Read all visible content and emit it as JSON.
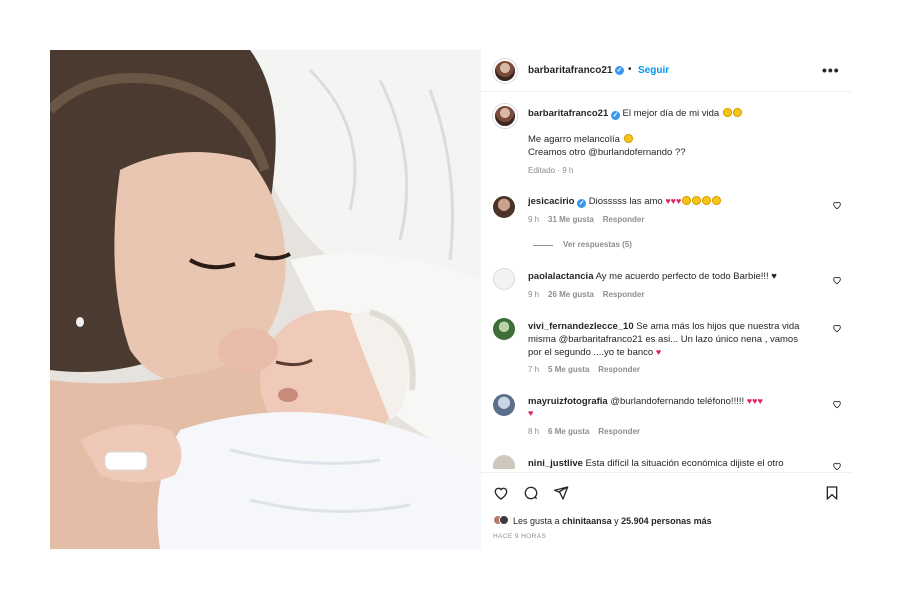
{
  "post": {
    "author": "barbaritafranco21",
    "follow_label": "Seguir",
    "header_separator": "•",
    "more_label": "•••",
    "caption_user": "barbaritafranco21",
    "caption_line1": "El mejor día de mi vida",
    "caption_line2": "Me agarro melancolía",
    "caption_line3": "Creamos otro @burlandofernando ??",
    "caption_meta": "Editado · 9 h"
  },
  "comments": [
    {
      "user": "jesicacirio",
      "text": "Diosssss las amo",
      "time": "9 h",
      "likes": "31 Me gusta",
      "reply": "Responder",
      "view_replies": "Ver respuestas (5)"
    },
    {
      "user": "paolalactancia",
      "text": "Ay me acuerdo perfecto de todo Barbie!!! ♥",
      "time": "9 h",
      "likes": "26 Me gusta",
      "reply": "Responder"
    },
    {
      "user": "vivi_fernandezlecce_10",
      "text_line1": "Se ama más los hijos que nuestra vida",
      "text_line2": "misma @barbaritafranco21 es asi... Un lazo único nena , vamos",
      "text_line3": "por el segundo ....yo te banco",
      "time": "7 h",
      "likes": "5 Me gusta",
      "reply": "Responder"
    },
    {
      "user": "mayruizfotografia",
      "text": "@burlandofernando teléfono!!!!!",
      "time": "8 h",
      "likes": "6 Me gusta",
      "reply": "Responder"
    },
    {
      "user": "nini_justlive",
      "text": "Esta difícil la situación económica dijiste el otro"
    }
  ],
  "footer": {
    "likes_prefix": "Les gusta a",
    "likes_user": "chinitaansa",
    "likes_connector": "y",
    "likes_count": "25.904 personas más",
    "timestamp": "HACE 9 HORAS"
  },
  "icons": {
    "like": "heart-icon",
    "comment": "comment-icon",
    "share": "send-icon",
    "save": "bookmark-icon"
  },
  "colors": {
    "link": "#0095f6",
    "verified": "#3897f0",
    "muted": "#8e8e8e",
    "heart": "#e0245e"
  }
}
